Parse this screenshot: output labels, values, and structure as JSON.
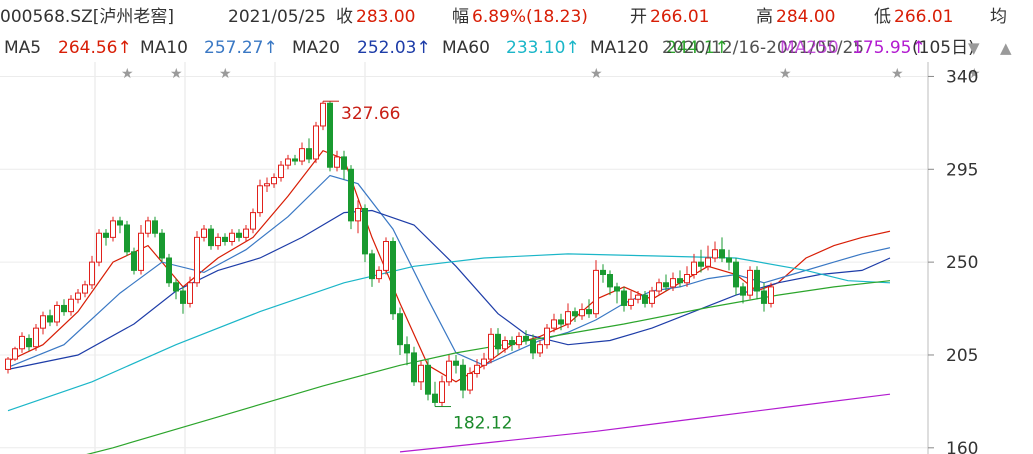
{
  "header": {
    "stock_id": "000568.SZ[泸州老窖]",
    "date": "2021/05/25",
    "close_label": "收",
    "close_value": "283.00",
    "change_label": "幅",
    "change_value": "6.89%(18.23)",
    "open_label": "开",
    "open_value": "266.01",
    "high_label": "高",
    "high_value": "284.00",
    "low_label": "低",
    "low_value": "266.01",
    "avg_label": "均"
  },
  "ma_legend": [
    {
      "label": "MA5",
      "value": "264.56↑",
      "color": "#d81e06"
    },
    {
      "label": "MA10",
      "value": "257.27↑",
      "color": "#3a78c4"
    },
    {
      "label": "MA20",
      "value": "252.03↑",
      "color": "#1e3da8"
    },
    {
      "label": "MA60",
      "value": "233.10↑",
      "color": "#1bb6c8"
    },
    {
      "label": "MA120",
      "value": "244.1↑",
      "color": "#2ca52c"
    },
    {
      "label": "MA250",
      "value": "175.95↑",
      "color": "#b21bd0"
    }
  ],
  "overlay_text": {
    "date_range": "2020/12/16-2021/05/25",
    "period": "(105日)"
  },
  "controls": {
    "expand_icon": "triangle-down-icon",
    "collapse_icon": "triangle-up-icon"
  },
  "colors": {
    "up": "#e1211c",
    "down": "#199a30"
  },
  "chart_data": {
    "type": "candlestick",
    "y_ticks": [
      340,
      295,
      250,
      205,
      160
    ],
    "ylim": [
      157,
      347
    ],
    "annotations": [
      {
        "label": "327.66",
        "kind": "high",
        "index": 45
      },
      {
        "label": "182.12",
        "kind": "low",
        "index": 61
      }
    ],
    "candles": [
      [
        198,
        203,
        196,
        204
      ],
      [
        203,
        208,
        202,
        209
      ],
      [
        208,
        214,
        206,
        216
      ],
      [
        213,
        209,
        207,
        215
      ],
      [
        209,
        218,
        207,
        220
      ],
      [
        218,
        224,
        215,
        226
      ],
      [
        224,
        221,
        219,
        227
      ],
      [
        221,
        229,
        219,
        231
      ],
      [
        229,
        226,
        224,
        232
      ],
      [
        226,
        232,
        224,
        234
      ],
      [
        232,
        235,
        230,
        237
      ],
      [
        235,
        239,
        233,
        241
      ],
      [
        239,
        250,
        237,
        253
      ],
      [
        250,
        264,
        248,
        266
      ],
      [
        264,
        262,
        258,
        266
      ],
      [
        262,
        270,
        260,
        272
      ],
      [
        270,
        268,
        264,
        272
      ],
      [
        268,
        255,
        253,
        270
      ],
      [
        255,
        246,
        244,
        257
      ],
      [
        246,
        264,
        244,
        268
      ],
      [
        264,
        270,
        262,
        272
      ],
      [
        270,
        264,
        262,
        272
      ],
      [
        264,
        252,
        250,
        266
      ],
      [
        252,
        240,
        238,
        254
      ],
      [
        240,
        236,
        232,
        242
      ],
      [
        236,
        230,
        225,
        238
      ],
      [
        230,
        240,
        228,
        243
      ],
      [
        240,
        262,
        238,
        265
      ],
      [
        262,
        266,
        260,
        268
      ],
      [
        266,
        258,
        256,
        268
      ],
      [
        258,
        262,
        256,
        264
      ],
      [
        262,
        260,
        258,
        264
      ],
      [
        260,
        264,
        258,
        266
      ],
      [
        264,
        262,
        260,
        266
      ],
      [
        262,
        266,
        260,
        268
      ],
      [
        266,
        274,
        264,
        276
      ],
      [
        274,
        287,
        272,
        290
      ],
      [
        287,
        288,
        284,
        291
      ],
      [
        288,
        291,
        286,
        293
      ],
      [
        291,
        297,
        289,
        299
      ],
      [
        297,
        300,
        295,
        302
      ],
      [
        300,
        299,
        297,
        302
      ],
      [
        299,
        305,
        297,
        308
      ],
      [
        305,
        300,
        298,
        310
      ],
      [
        300,
        316,
        298,
        318
      ],
      [
        316,
        327,
        314,
        328
      ],
      [
        327,
        296,
        294,
        328
      ],
      [
        296,
        301,
        294,
        304
      ],
      [
        301,
        295,
        290,
        304
      ],
      [
        295,
        270,
        266,
        297
      ],
      [
        270,
        276,
        264,
        280
      ],
      [
        276,
        254,
        250,
        278
      ],
      [
        254,
        242,
        238,
        256
      ],
      [
        242,
        246,
        240,
        248
      ],
      [
        246,
        260,
        244,
        262
      ],
      [
        260,
        225,
        222,
        262
      ],
      [
        225,
        210,
        205,
        228
      ],
      [
        210,
        206,
        200,
        214
      ],
      [
        206,
        192,
        190,
        209
      ],
      [
        192,
        200,
        188,
        202
      ],
      [
        200,
        186,
        183,
        203
      ],
      [
        186,
        182,
        180,
        192
      ],
      [
        182,
        192,
        180,
        195
      ],
      [
        192,
        202,
        190,
        205
      ],
      [
        202,
        200,
        196,
        205
      ],
      [
        200,
        188,
        184,
        203
      ],
      [
        188,
        196,
        186,
        199
      ],
      [
        196,
        200,
        194,
        203
      ],
      [
        200,
        203,
        198,
        206
      ],
      [
        203,
        215,
        201,
        218
      ],
      [
        215,
        208,
        205,
        218
      ],
      [
        208,
        212,
        206,
        214
      ],
      [
        212,
        210,
        207,
        214
      ],
      [
        210,
        214,
        208,
        216
      ],
      [
        214,
        212,
        210,
        217
      ],
      [
        212,
        206,
        203,
        215
      ],
      [
        206,
        210,
        204,
        212
      ],
      [
        210,
        218,
        208,
        220
      ],
      [
        218,
        222,
        216,
        225
      ],
      [
        222,
        220,
        217,
        225
      ],
      [
        220,
        226,
        218,
        230
      ],
      [
        226,
        224,
        221,
        228
      ],
      [
        224,
        227,
        222,
        230
      ],
      [
        227,
        225,
        223,
        232
      ],
      [
        225,
        246,
        223,
        251
      ],
      [
        246,
        244,
        240,
        249
      ],
      [
        244,
        238,
        234,
        246
      ],
      [
        238,
        236,
        230,
        240
      ],
      [
        236,
        229,
        226,
        238
      ],
      [
        229,
        232,
        227,
        236
      ],
      [
        232,
        234,
        230,
        236
      ],
      [
        234,
        230,
        228,
        236
      ],
      [
        230,
        236,
        228,
        238
      ],
      [
        236,
        240,
        234,
        242
      ],
      [
        240,
        238,
        236,
        244
      ],
      [
        238,
        242,
        236,
        245
      ],
      [
        242,
        240,
        238,
        246
      ],
      [
        240,
        244,
        238,
        248
      ],
      [
        244,
        250,
        242,
        254
      ],
      [
        250,
        248,
        245,
        256
      ],
      [
        248,
        252,
        246,
        258
      ],
      [
        252,
        256,
        250,
        260
      ],
      [
        256,
        252,
        250,
        262
      ],
      [
        252,
        250,
        246,
        256
      ],
      [
        250,
        238,
        234,
        252
      ],
      [
        238,
        234,
        230,
        240
      ],
      [
        234,
        246,
        232,
        248
      ],
      [
        246,
        236,
        232,
        248
      ],
      [
        236,
        230,
        226,
        240
      ],
      [
        230,
        238,
        228,
        240
      ]
    ],
    "series": [
      {
        "name": "MA5",
        "values": [
          [
            0,
            202
          ],
          [
            5,
            210
          ],
          [
            10,
            226
          ],
          [
            15,
            250
          ],
          [
            20,
            258
          ],
          [
            25,
            238
          ],
          [
            30,
            252
          ],
          [
            35,
            262
          ],
          [
            40,
            282
          ],
          [
            45,
            304
          ],
          [
            48,
            300
          ],
          [
            52,
            262
          ],
          [
            56,
            230
          ],
          [
            60,
            200
          ],
          [
            64,
            192
          ],
          [
            68,
            200
          ],
          [
            72,
            210
          ],
          [
            76,
            214
          ],
          [
            80,
            220
          ],
          [
            84,
            232
          ],
          [
            88,
            238
          ],
          [
            92,
            232
          ],
          [
            96,
            240
          ],
          [
            100,
            248
          ],
          [
            104,
            244
          ],
          [
            107,
            236
          ],
          [
            110,
            240
          ],
          [
            114,
            252
          ],
          [
            118,
            258
          ],
          [
            122,
            262
          ],
          [
            126,
            265
          ]
        ]
      },
      {
        "name": "MA10",
        "values": [
          [
            0,
            199
          ],
          [
            8,
            210
          ],
          [
            16,
            235
          ],
          [
            22,
            250
          ],
          [
            28,
            245
          ],
          [
            34,
            256
          ],
          [
            40,
            272
          ],
          [
            46,
            292
          ],
          [
            50,
            288
          ],
          [
            55,
            266
          ],
          [
            60,
            232
          ],
          [
            64,
            206
          ],
          [
            68,
            200
          ],
          [
            72,
            206
          ],
          [
            76,
            212
          ],
          [
            80,
            216
          ],
          [
            84,
            222
          ],
          [
            88,
            230
          ],
          [
            92,
            236
          ],
          [
            96,
            238
          ],
          [
            100,
            242
          ],
          [
            104,
            244
          ],
          [
            108,
            240
          ],
          [
            112,
            244
          ],
          [
            118,
            250
          ],
          [
            122,
            254
          ],
          [
            126,
            257
          ]
        ]
      },
      {
        "name": "MA20",
        "values": [
          [
            0,
            198
          ],
          [
            10,
            205
          ],
          [
            18,
            220
          ],
          [
            24,
            236
          ],
          [
            30,
            246
          ],
          [
            36,
            252
          ],
          [
            42,
            262
          ],
          [
            48,
            274
          ],
          [
            52,
            275
          ],
          [
            58,
            268
          ],
          [
            64,
            248
          ],
          [
            70,
            225
          ],
          [
            74,
            215
          ],
          [
            80,
            210
          ],
          [
            86,
            212
          ],
          [
            92,
            218
          ],
          [
            98,
            226
          ],
          [
            104,
            234
          ],
          [
            110,
            240
          ],
          [
            116,
            244
          ],
          [
            122,
            246
          ],
          [
            126,
            252
          ]
        ]
      },
      {
        "name": "MA60",
        "values": [
          [
            0,
            178
          ],
          [
            12,
            192
          ],
          [
            24,
            210
          ],
          [
            36,
            226
          ],
          [
            48,
            240
          ],
          [
            58,
            248
          ],
          [
            68,
            252
          ],
          [
            80,
            254
          ],
          [
            92,
            253
          ],
          [
            104,
            252
          ],
          [
            114,
            246
          ],
          [
            120,
            241
          ],
          [
            126,
            240
          ]
        ]
      },
      {
        "name": "MA120",
        "values": [
          [
            0,
            147
          ],
          [
            15,
            160
          ],
          [
            30,
            175
          ],
          [
            45,
            190
          ],
          [
            56,
            200
          ],
          [
            64,
            206
          ],
          [
            76,
            213
          ],
          [
            88,
            220
          ],
          [
            100,
            228
          ],
          [
            110,
            234
          ],
          [
            118,
            238
          ],
          [
            126,
            241
          ]
        ]
      },
      {
        "name": "MA250",
        "values": [
          [
            56,
            158
          ],
          [
            70,
            163
          ],
          [
            84,
            168
          ],
          [
            98,
            174
          ],
          [
            112,
            180
          ],
          [
            126,
            186
          ]
        ]
      }
    ]
  }
}
